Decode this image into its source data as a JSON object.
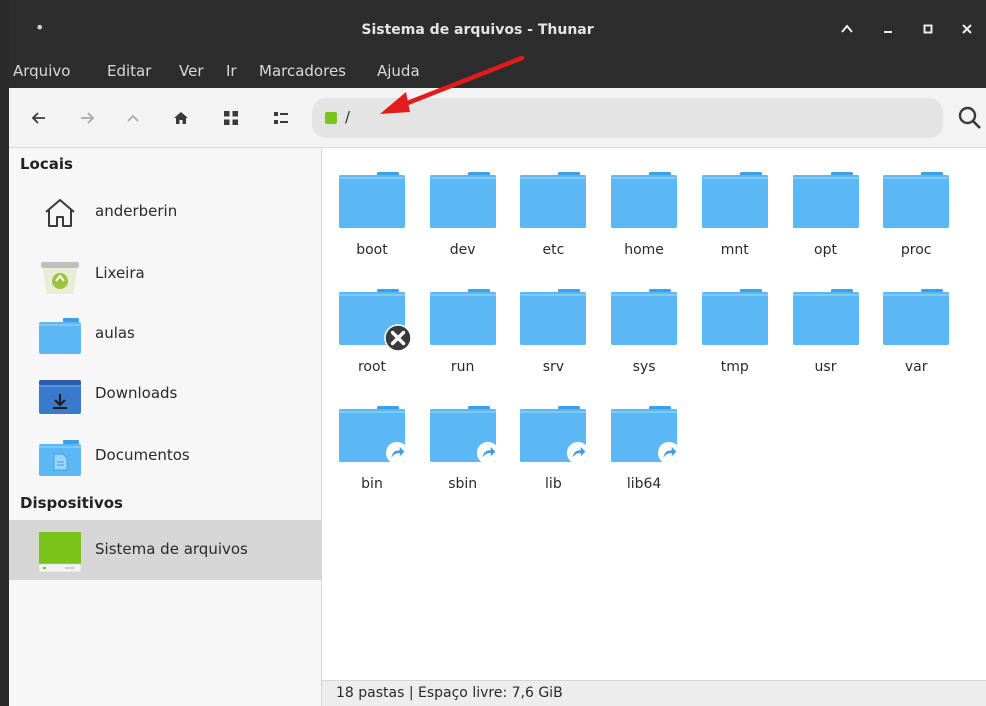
{
  "window": {
    "title": "Sistema de arquivos - Thunar",
    "menu_dot": "•",
    "buttons": [
      "^",
      "–",
      "▫",
      "×"
    ]
  },
  "menu": [
    "Arquivo",
    "Editar",
    "Ver",
    "Ir",
    "Marcadores",
    "Ajuda"
  ],
  "toolbar": {
    "back_icon": "arrow-left-icon",
    "forward_icon": "arrow-right-icon",
    "up_icon": "chevron-up-icon",
    "home_icon": "home-icon",
    "icon_view_icon": "grid-view-icon",
    "list_view_icon": "list-view-icon",
    "search_icon": "search-icon"
  },
  "location": {
    "path": "/",
    "drive_color": "#79c51a"
  },
  "sidebar": {
    "sections": [
      {
        "title": "Locais",
        "items": [
          {
            "label": "anderberin",
            "icon": "home-outline-icon"
          },
          {
            "label": "Lixeira",
            "icon": "trash-icon"
          },
          {
            "label": "aulas",
            "icon": "folder-icon"
          },
          {
            "label": "Downloads",
            "icon": "downloads-folder-icon"
          },
          {
            "label": "Documentos",
            "icon": "documents-folder-icon"
          }
        ]
      },
      {
        "title": "Dispositivos",
        "items": [
          {
            "label": "Sistema de arquivos",
            "icon": "drive-icon",
            "active": true
          }
        ]
      }
    ]
  },
  "folders": [
    {
      "name": "boot",
      "badge": ""
    },
    {
      "name": "dev",
      "badge": ""
    },
    {
      "name": "etc",
      "badge": ""
    },
    {
      "name": "home",
      "badge": ""
    },
    {
      "name": "mnt",
      "badge": ""
    },
    {
      "name": "opt",
      "badge": ""
    },
    {
      "name": "proc",
      "badge": ""
    },
    {
      "name": "root",
      "badge": "no-access"
    },
    {
      "name": "run",
      "badge": ""
    },
    {
      "name": "srv",
      "badge": ""
    },
    {
      "name": "sys",
      "badge": ""
    },
    {
      "name": "tmp",
      "badge": ""
    },
    {
      "name": "usr",
      "badge": ""
    },
    {
      "name": "var",
      "badge": ""
    },
    {
      "name": "bin",
      "badge": "symlink"
    },
    {
      "name": "sbin",
      "badge": "symlink"
    },
    {
      "name": "lib",
      "badge": "symlink"
    },
    {
      "name": "lib64",
      "badge": "symlink"
    }
  ],
  "statusbar": {
    "text": "18 pastas  |  Espaço livre: 7,6 GiB"
  },
  "colors": {
    "folder": "#5cb8f5",
    "folder_tab": "#3f9fe6",
    "titlebar": "#2d2d2d",
    "annotation_arrow": "#e31b1b",
    "active_sidebar": "#d6d6d6"
  }
}
